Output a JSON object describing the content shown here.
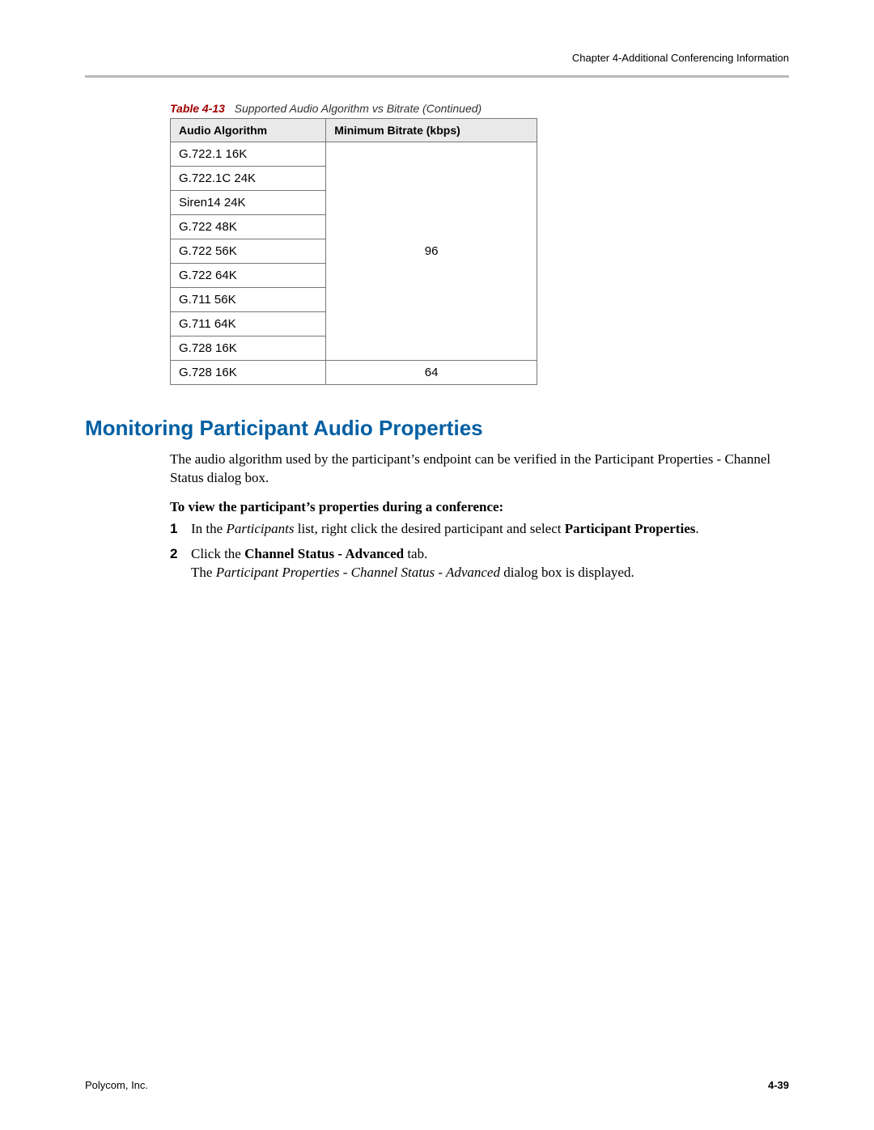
{
  "chapter_header": "Chapter 4-Additional Conferencing Information",
  "table": {
    "label": "Table 4-13",
    "desc": "Supported Audio Algorithm vs Bitrate (Continued)",
    "headers": [
      "Audio Algorithm",
      "Minimum Bitrate (kbps)"
    ],
    "group1_bitrate": "96",
    "group1_algorithms": [
      "G.722.1 16K",
      "G.722.1C 24K",
      "Siren14 24K",
      "G.722 48K",
      "G.722 56K",
      "G.722 64K",
      "G.711 56K",
      "G.711 64K",
      "G.728 16K"
    ],
    "row2_alg": "G.728 16K",
    "row2_bitrate": "64"
  },
  "heading": "Monitoring Participant Audio Properties",
  "intro": "The audio algorithm used by the participant’s endpoint can be verified in the Participant Properties - Channel Status dialog box.",
  "subhead": "To view the participant’s properties during a conference:",
  "step1": {
    "num": "1",
    "pre": "In the ",
    "ital": "Participants",
    "mid": " list, right click the desired participant and select ",
    "bold": "Participant Properties",
    "post": "."
  },
  "step2": {
    "num": "2",
    "line1_pre": "Click the ",
    "line1_bold": "Channel Status - Advanced",
    "line1_post": " tab.",
    "line2_pre": "The ",
    "line2_ital": "Participant Properties - Channel Status - Advanced",
    "line2_post": " dialog box is displayed."
  },
  "footer_left": "Polycom, Inc.",
  "footer_right": "4-39"
}
